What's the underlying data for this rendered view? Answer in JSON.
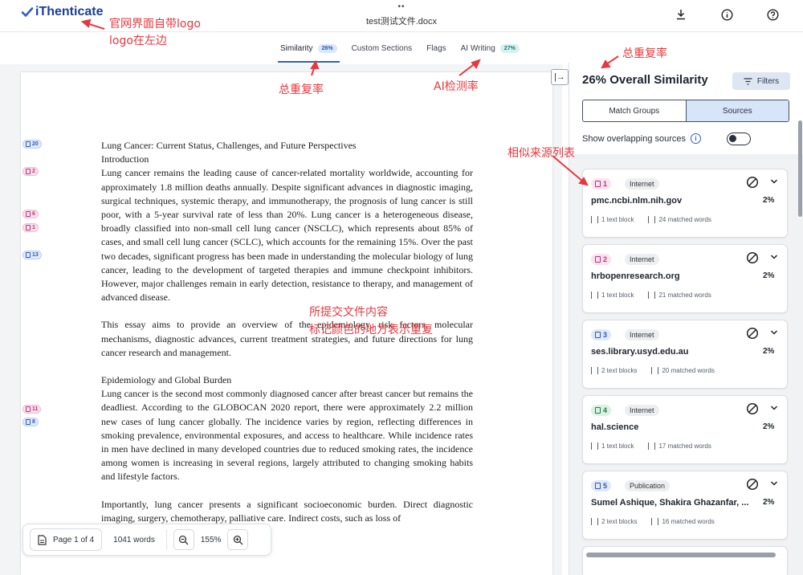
{
  "header": {
    "logo_text": "iThenticate",
    "doc_dots": "••",
    "doc_title": "test测试文件.docx"
  },
  "tabs": [
    {
      "label": "Similarity",
      "badge": "26%"
    },
    {
      "label": "Custom Sections"
    },
    {
      "label": "Flags"
    },
    {
      "label": "AI Writing",
      "badge": "27%"
    }
  ],
  "document": {
    "title": "Lung Cancer: Current Status, Challenges, and Future Perspectives",
    "intro_heading": "Introduction",
    "intro_body": "Lung cancer remains the leading cause of cancer-related mortality worldwide, accounting for approximately 1.8 million deaths annually. Despite significant advances in diagnostic imaging, surgical techniques, systemic therapy, and immunotherapy, the prognosis of lung cancer is still poor, with a 5-year survival rate of less than 20%. Lung cancer is a heterogeneous disease, broadly classified into non-small cell lung cancer (NSCLC), which represents about 85% of cases, and small cell lung cancer (SCLC), which accounts for the remaining 15%. Over the past two decades, significant progress has been made in understanding the molecular biology of lung cancer, leading to the development of targeted therapies and immune checkpoint inhibitors. However, major challenges remain in early detection, resistance to therapy, and management of advanced disease.",
    "essay_aim": "This essay aims to provide an overview of the epidemiology, risk factors, molecular mechanisms, diagnostic advances, current treatment strategies, and future directions for lung cancer research and management.",
    "epi_heading": "Epidemiology and Global Burden",
    "epi_body": "Lung cancer is the second most commonly diagnosed cancer after breast cancer but remains the deadliest. According to the GLOBOCAN 2020 report, there were approximately 2.2 million new cases of lung cancer globally. The incidence varies by region, reflecting differences in smoking prevalence, environmental exposures, and access to healthcare. While incidence rates in men have declined in many developed countries due to reduced smoking rates, the incidence among women is increasing in several regions, largely attributed to changing smoking habits and lifestyle factors.",
    "last_para": "Importantly, lung cancer presents a significant socioeconomic burden. Direct diagnostic imaging, surgery, chemotherapy, palliative care. Indirect costs, such as loss of",
    "margin_badges": [
      "20",
      "2",
      "6",
      "1",
      "13",
      "11",
      "8"
    ]
  },
  "bottom_bar": {
    "page_label": "Page 1 of 4",
    "words_label": "1041 words",
    "zoom_label": "155%"
  },
  "panel": {
    "title": "26% Overall Similarity",
    "filters_label": "Filters",
    "seg_match": "Match Groups",
    "seg_sources": "Sources",
    "overlap_label": "Show overlapping sources",
    "info_glyph": "i",
    "collapse_glyph": "|→"
  },
  "sources": [
    {
      "num": "1",
      "type": "Internet",
      "name": "pmc.ncbi.nlm.nih.gov",
      "pct": "2%",
      "blocks": "1 text block",
      "words": "24 matched words",
      "color": "pink"
    },
    {
      "num": "2",
      "type": "Internet",
      "name": "hrbopenresearch.org",
      "pct": "2%",
      "blocks": "1 text block",
      "words": "21 matched words",
      "color": "pink"
    },
    {
      "num": "3",
      "type": "Internet",
      "name": "ses.library.usyd.edu.au",
      "pct": "2%",
      "blocks": "2 text blocks",
      "words": "20 matched words",
      "color": "blue"
    },
    {
      "num": "4",
      "type": "Internet",
      "name": "hal.science",
      "pct": "2%",
      "blocks": "1 text block",
      "words": "17 matched words",
      "color": "green"
    },
    {
      "num": "5",
      "type": "Publication",
      "name": "Sumel Ashique, Shakira Ghazanfar, ...",
      "pct": "2%",
      "blocks": "2 text blocks",
      "words": "16 matched words",
      "color": "blue"
    }
  ],
  "annotations": {
    "logo_note_1": "官网界面自带logo",
    "logo_note_2": "logo在左边",
    "overall_rate_tab": "总重复率",
    "ai_rate": "AI检测率",
    "overall_rate_panel": "总重复率",
    "source_list": "相似来源列表",
    "content_note_1": "所提交文件内容",
    "content_note_2": "标记颜色的地方表示重复"
  },
  "colors": {
    "brand": "#1c3f95",
    "accent": "#2b5fc7",
    "annotation_red": "#e8383d",
    "highlight_pink": "#fbe7f1",
    "highlight_blue": "#e6eefc"
  }
}
